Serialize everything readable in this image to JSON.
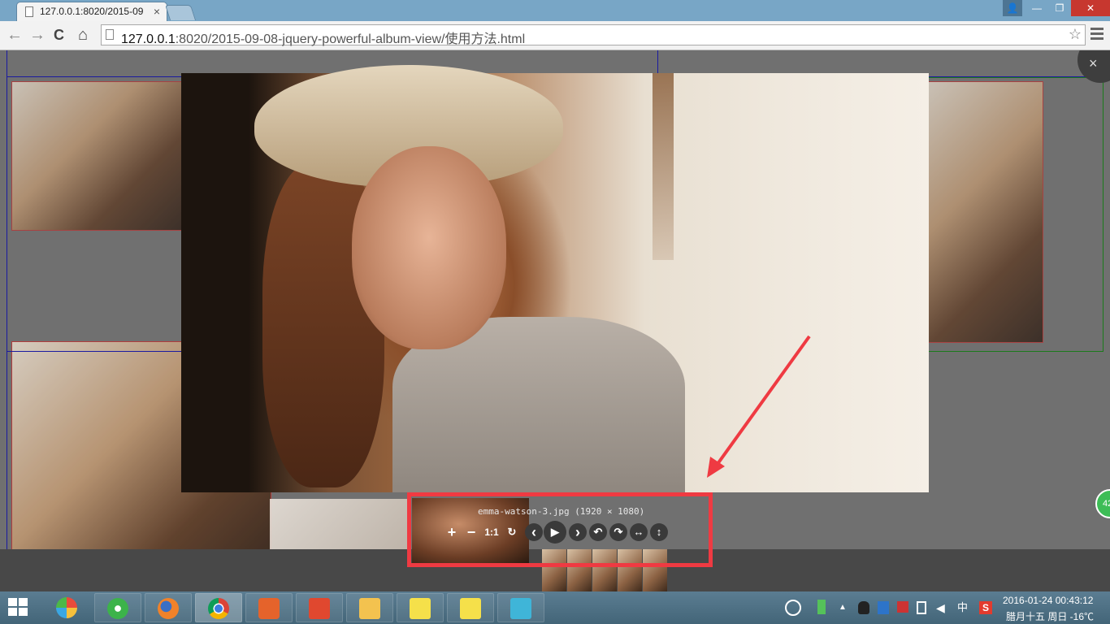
{
  "browser": {
    "tab_title": "127.0.0.1:8020/2015-09",
    "tab_close": "×",
    "nav_back": "←",
    "nav_forward": "→",
    "nav_reload": "C",
    "nav_home": "⌂",
    "url_host": "127.0.0.1",
    "url_rest": ":8020/2015-09-08-jquery-powerful-album-view/使用方法.html",
    "star": "☆",
    "window_user": "👤",
    "window_minimize": "—",
    "window_restore": "❐",
    "window_close": "✕"
  },
  "viewer": {
    "close": "×",
    "caption": "emma-watson-3.jpg (1920 × 1080)",
    "controls": {
      "zoom_in": "+",
      "zoom_out": "−",
      "actual_size": "1:1",
      "reset": "↻",
      "prev": "‹",
      "play": "▶",
      "next": "›",
      "rotate_left": "↶",
      "rotate_right": "↷",
      "flip_horizontal": "↔",
      "flip_vertical": "↕"
    },
    "badge": "42"
  },
  "taskbar": {
    "clock_time": "2016-01-24  00:43:12",
    "clock_date": "腊月十五 周日 -16℃",
    "tray_ime": "中",
    "tray_sogou": "S"
  },
  "colors": {
    "highlight": "#ef3a42",
    "titlebar": "#78a6c6",
    "overlay": "#707070"
  }
}
